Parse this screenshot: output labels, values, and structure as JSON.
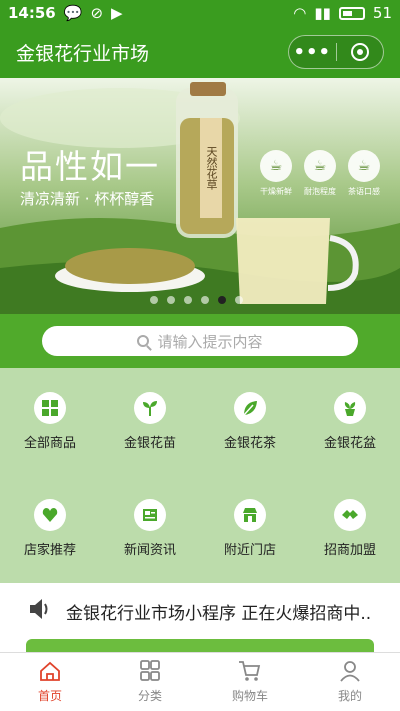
{
  "status": {
    "time": "14:56",
    "battery": "51"
  },
  "appbar": {
    "title": "金银花行业市场",
    "menu_label": "•••"
  },
  "banner": {
    "headline": "品性如一",
    "subline": "清凉清新 · 杯杯醇香",
    "bottle_label": "天然花草",
    "badges": [
      "干燥新鲜",
      "耐泡程度",
      "茶语口感"
    ],
    "slides_total": 6,
    "active_slide": 5
  },
  "search": {
    "placeholder": "请输入提示内容"
  },
  "categories": [
    {
      "label": "全部商品",
      "icon": "grid-icon"
    },
    {
      "label": "金银花苗",
      "icon": "seedling-icon"
    },
    {
      "label": "金银花茶",
      "icon": "tea-leaf-icon"
    },
    {
      "label": "金银花盆",
      "icon": "potted-plant-icon"
    },
    {
      "label": "店家推荐",
      "icon": "heart-icon"
    },
    {
      "label": "新闻资讯",
      "icon": "newspaper-icon"
    },
    {
      "label": "附近门店",
      "icon": "store-icon"
    },
    {
      "label": "招商加盟",
      "icon": "handshake-icon"
    }
  ],
  "notice": {
    "text": "金银花行业市场小程序 正在火爆招商中..."
  },
  "tabs": [
    {
      "label": "首页",
      "icon": "home-icon",
      "active": true
    },
    {
      "label": "分类",
      "icon": "category-icon",
      "active": false
    },
    {
      "label": "购物车",
      "icon": "cart-icon",
      "active": false
    },
    {
      "label": "我的",
      "icon": "user-icon",
      "active": false
    }
  ],
  "colors": {
    "brand": "#3a9c1f",
    "active_tab": "#e0432b",
    "grid_bg": "#bcdcab"
  }
}
